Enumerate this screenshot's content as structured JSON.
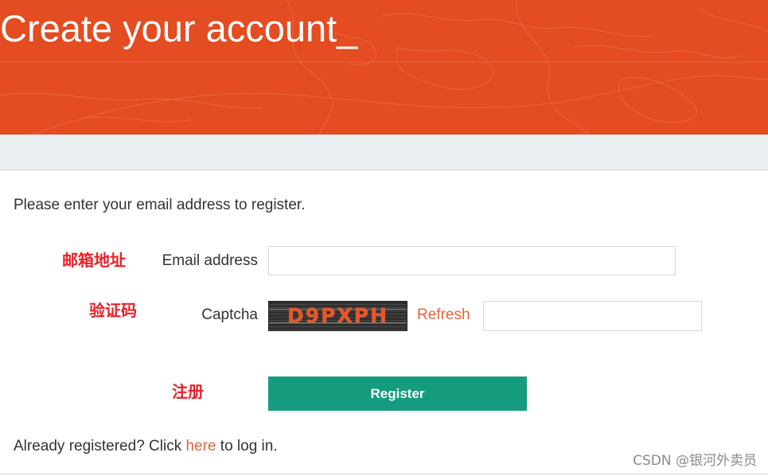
{
  "header": {
    "title": "Create your account_",
    "background_color": "#e44c22"
  },
  "form": {
    "intro": "Please enter your email address to register.",
    "email_label": "Email address",
    "email_value": "",
    "captcha_label": "Captcha",
    "captcha_code": "D9PXPH",
    "refresh_label": "Refresh",
    "captcha_value": "",
    "register_label": "Register",
    "register_color": "#159c7f",
    "link_color": "#e5643c"
  },
  "annotations": {
    "email": "邮箱地址",
    "captcha": "验证码",
    "register": "注册",
    "color": "#e8202a"
  },
  "footer": {
    "login_prefix": "Already registered? Click ",
    "login_link": "here",
    "login_suffix": " to log in."
  },
  "watermark": "CSDN @银河外卖员"
}
